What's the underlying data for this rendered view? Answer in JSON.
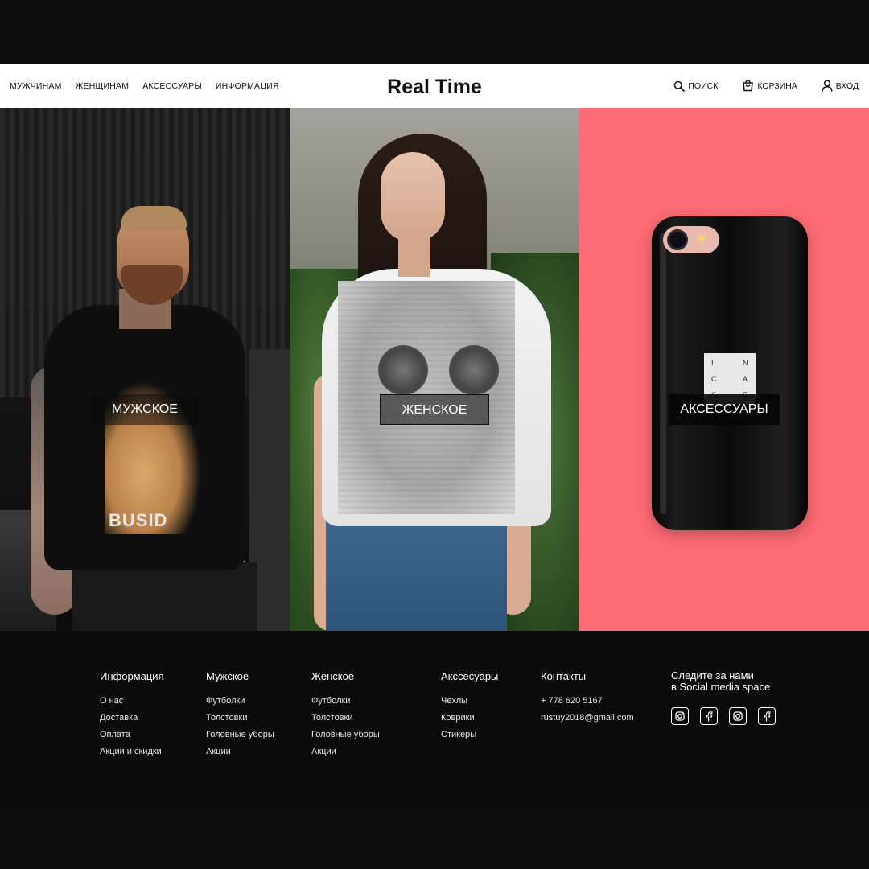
{
  "header": {
    "nav": [
      "МУЖЧИНАМ",
      "ЖЕНЩИНАМ",
      "АКСЕССУАРЫ",
      "ИНФОРМАЦИЯ"
    ],
    "logo": "Real Time",
    "search_label": "ПОИСК",
    "cart_label": "КОРЗИНА",
    "login_label": "ВХОД",
    "icons": [
      "search-icon",
      "cart-icon",
      "user-icon"
    ]
  },
  "categories": [
    {
      "label": "МУЖСКОЕ"
    },
    {
      "label": "ЖЕНСКОЕ"
    },
    {
      "label": "АКСЕССУАРЫ"
    }
  ],
  "hero": {
    "men_print_text": "BUSID",
    "phone_logo_letters": [
      "I",
      "N",
      "C",
      "A",
      "S",
      "E"
    ],
    "accessory_bg_color": "#fd6b74"
  },
  "footer": {
    "columns": [
      {
        "title": "Информация",
        "links": [
          "О нас",
          "Доставка",
          "Оплата",
          "Акции и скидки"
        ]
      },
      {
        "title": "Мужское",
        "links": [
          "Футболки",
          "Толстовки",
          "Головные уборы",
          "Акции"
        ]
      },
      {
        "title": "Женское",
        "links": [
          "Футболки",
          "Толстовки",
          "Головные уборы",
          "Акции"
        ]
      },
      {
        "title": "Акссесуары",
        "links": [
          "Чехлы",
          "Коврики",
          "Стикеры"
        ]
      },
      {
        "title": "Контакты",
        "links": [
          "+ 778 620 5167",
          "rustuy2018@gmail.com"
        ]
      }
    ],
    "social": {
      "title_line1": "Следите за нами",
      "title_line2": "в Social media space",
      "icons": [
        "instagram-icon",
        "facebook-icon",
        "instagram-icon",
        "facebook-icon"
      ]
    }
  }
}
